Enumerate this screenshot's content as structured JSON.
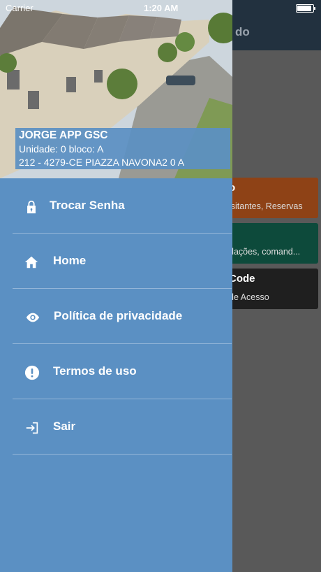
{
  "status_bar": {
    "carrier": "Carrier",
    "time": "1:20 AM"
  },
  "background": {
    "title": "do",
    "cards": [
      {
        "title": "o",
        "subtitle": "isitantes, Reservas",
        "color": "#8e4216"
      },
      {
        "title": "",
        "subtitle": "dações, comand...",
        "color": "#0d4a3b"
      },
      {
        "title": "Code",
        "subtitle": "de Acesso",
        "color": "#1f1f1f"
      }
    ]
  },
  "drawer": {
    "user": {
      "name": "JORGE APP GSC",
      "unit": "Unidade: 0 bloco: A",
      "address": "212 - 4279-CE PIAZZA NAVONA2 0 A"
    },
    "menu": [
      {
        "label": "Trocar Senha",
        "icon": "lock-icon"
      },
      {
        "label": "Home",
        "icon": "home-icon"
      },
      {
        "label": "Política de privacidade",
        "icon": "eye-icon"
      },
      {
        "label": "Termos de uso",
        "icon": "exclamation-icon"
      },
      {
        "label": "Sair",
        "icon": "logout-icon"
      }
    ],
    "colors": {
      "drawer": "#5b90c3",
      "text": "#ffffff"
    }
  }
}
